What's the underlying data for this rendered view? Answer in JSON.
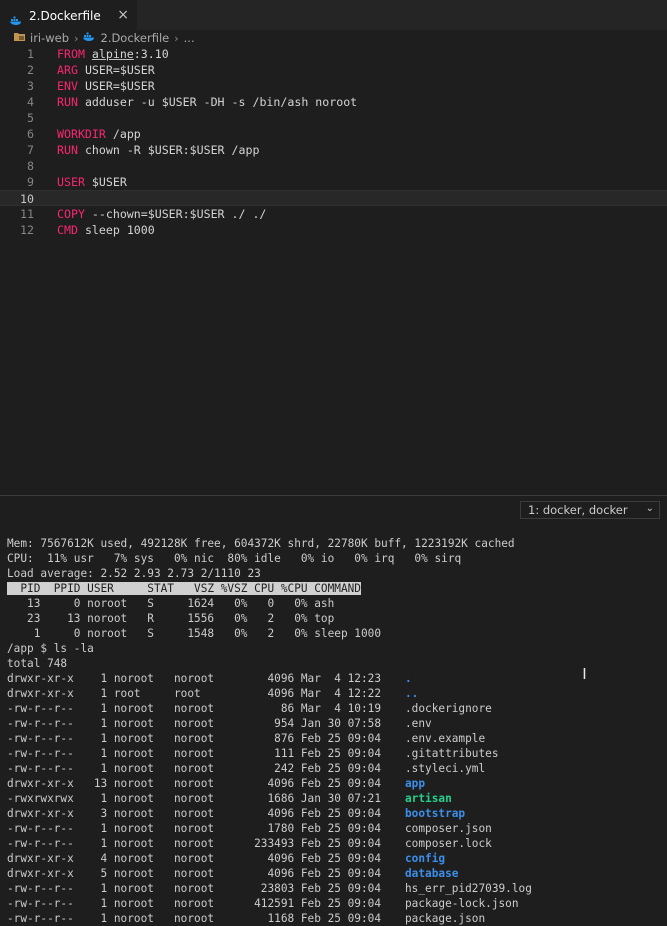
{
  "tab": {
    "label": "2.Dockerfile",
    "close": "×"
  },
  "breadcrumb": {
    "folder": "iri-web",
    "file": "2.Dockerfile",
    "ellipsis": "..."
  },
  "editor": {
    "current_line": 10,
    "lines": [
      {
        "num": "1",
        "kw": "FROM",
        "pre": "",
        "ul": "alpine",
        "rest": ":3.10"
      },
      {
        "num": "2",
        "kw": "ARG",
        "pre": "USER=$USER"
      },
      {
        "num": "3",
        "kw": "ENV",
        "pre": "USER=$USER"
      },
      {
        "num": "4",
        "kw": "RUN",
        "pre": "adduser -u $USER -DH -s /bin/ash noroot"
      },
      {
        "num": "5",
        "kw": "",
        "pre": ""
      },
      {
        "num": "6",
        "kw": "WORKDIR",
        "pre": "/app"
      },
      {
        "num": "7",
        "kw": "RUN",
        "pre": "chown -R $USER:$USER /app"
      },
      {
        "num": "8",
        "kw": "",
        "pre": ""
      },
      {
        "num": "9",
        "kw": "USER",
        "pre": "$USER"
      },
      {
        "num": "10",
        "kw": "",
        "pre": ""
      },
      {
        "num": "11",
        "kw": "COPY",
        "pre": "--chown=$USER:$USER ./ ./"
      },
      {
        "num": "12",
        "kw": "CMD",
        "pre": "sleep 1000"
      }
    ]
  },
  "terminal_panel": {
    "selector": "1: docker, docker"
  },
  "terminal": {
    "top": {
      "mem": "Mem: 7567612K used, 492128K free, 604372K shrd, 22780K buff, 1223192K cached",
      "cpu": "CPU:  11% usr   7% sys   0% nic  80% idle   0% io   0% irq   0% sirq",
      "load": "Load average: 2.52 2.93 2.73 2/1110 23",
      "header": "  PID  PPID USER     STAT   VSZ %VSZ CPU %CPU COMMAND",
      "processes": [
        "   13     0 noroot   S     1624   0%   0   0% ash",
        "   23    13 noroot   R     1556   0%   2   0% top",
        "    1     0 noroot   S     1548   0%   2   0% sleep 1000"
      ]
    },
    "prompt": "/app $ ls -la",
    "total": "total 748",
    "files": [
      {
        "meta": "drwxr-xr-x    1 noroot   noroot        4096 Mar  4 12:23",
        "name": ".",
        "type": "dir"
      },
      {
        "meta": "drwxr-xr-x    1 root     root          4096 Mar  4 12:22",
        "name": "..",
        "type": "dir"
      },
      {
        "meta": "-rw-r--r--    1 noroot   noroot          86 Mar  4 10:19",
        "name": ".dockerignore",
        "type": "file"
      },
      {
        "meta": "-rw-r--r--    1 noroot   noroot         954 Jan 30 07:58",
        "name": ".env",
        "type": "file"
      },
      {
        "meta": "-rw-r--r--    1 noroot   noroot         876 Feb 25 09:04",
        "name": ".env.example",
        "type": "file"
      },
      {
        "meta": "-rw-r--r--    1 noroot   noroot         111 Feb 25 09:04",
        "name": ".gitattributes",
        "type": "file"
      },
      {
        "meta": "-rw-r--r--    1 noroot   noroot         242 Feb 25 09:04",
        "name": ".styleci.yml",
        "type": "file"
      },
      {
        "meta": "drwxr-xr-x   13 noroot   noroot        4096 Feb 25 09:04",
        "name": "app",
        "type": "dir"
      },
      {
        "meta": "-rwxrwxrwx    1 noroot   noroot        1686 Jan 30 07:21",
        "name": "artisan",
        "type": "exe"
      },
      {
        "meta": "drwxr-xr-x    3 noroot   noroot        4096 Feb 25 09:04",
        "name": "bootstrap",
        "type": "dir"
      },
      {
        "meta": "-rw-r--r--    1 noroot   noroot        1780 Feb 25 09:04",
        "name": "composer.json",
        "type": "file"
      },
      {
        "meta": "-rw-r--r--    1 noroot   noroot      233493 Feb 25 09:04",
        "name": "composer.lock",
        "type": "file"
      },
      {
        "meta": "drwxr-xr-x    4 noroot   noroot        4096 Feb 25 09:04",
        "name": "config",
        "type": "dir"
      },
      {
        "meta": "drwxr-xr-x    5 noroot   noroot        4096 Feb 25 09:04",
        "name": "database",
        "type": "dir"
      },
      {
        "meta": "-rw-r--r--    1 noroot   noroot       23803 Feb 25 09:04",
        "name": "hs_err_pid27039.log",
        "type": "file"
      },
      {
        "meta": "-rw-r--r--    1 noroot   noroot      412591 Feb 25 09:04",
        "name": "package-lock.json",
        "type": "file"
      },
      {
        "meta": "-rw-r--r--    1 noroot   noroot        1168 Feb 25 09:04",
        "name": "package.json",
        "type": "file"
      }
    ]
  },
  "colors": {
    "keyword": "#f92672",
    "dir": "#3b8eea",
    "exe": "#23d18b",
    "docker_icon": "#2496ed"
  },
  "icons": {
    "tab": "docker-whale-icon",
    "folder": "folder-icon",
    "chevron": "chevron-right-icon",
    "cursor": "text-cursor-icon"
  }
}
